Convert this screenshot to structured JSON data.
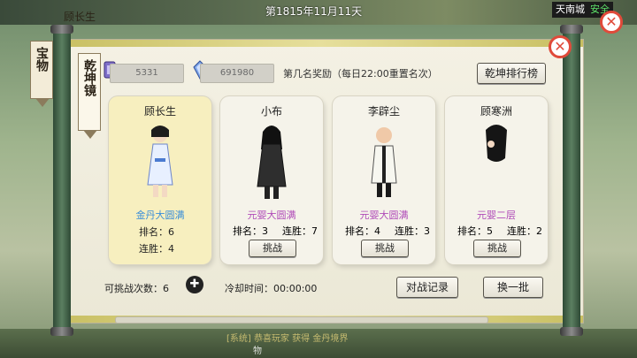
{
  "hud": {
    "player_name": "顾长生",
    "date": "第1815年11月11天",
    "location": "天南城",
    "safe_label": "安全",
    "news_line1": "[系统] 恭喜玩家 获得 金丹境界",
    "news_line2": "物"
  },
  "tabs": {
    "treasure": "宝物",
    "mirror": "乾坤镜"
  },
  "currency": {
    "left_value": "5331",
    "right_value": "691980"
  },
  "reward_text": "第几名奖励（每日22:00重置名次）",
  "buttons": {
    "rank_board": "乾坤排行榜",
    "record": "对战记录",
    "refresh": "换一批",
    "fight": "挑战"
  },
  "labels": {
    "rank": "排名：",
    "win": "连胜：",
    "challenge_count": "可挑战次数：",
    "cooldown": "冷却时间："
  },
  "footer": {
    "challenges_left": "6",
    "cooldown": "00:00:00"
  },
  "opponents": [
    {
      "name": "顾长生",
      "realm": "金丹大圆满",
      "rank": "6",
      "streak": "4",
      "is_self": true,
      "realm_color": "#3b8ed8"
    },
    {
      "name": "小布",
      "realm": "元婴大圆满",
      "rank": "3",
      "streak": "7",
      "is_self": false,
      "realm_color": "#b04bb8"
    },
    {
      "name": "李辟尘",
      "realm": "元婴大圆满",
      "rank": "4",
      "streak": "3",
      "is_self": false,
      "realm_color": "#b04bb8"
    },
    {
      "name": "顾寒洲",
      "realm": "元婴二层",
      "rank": "5",
      "streak": "2",
      "is_self": false,
      "realm_color": "#b04bb8"
    }
  ]
}
